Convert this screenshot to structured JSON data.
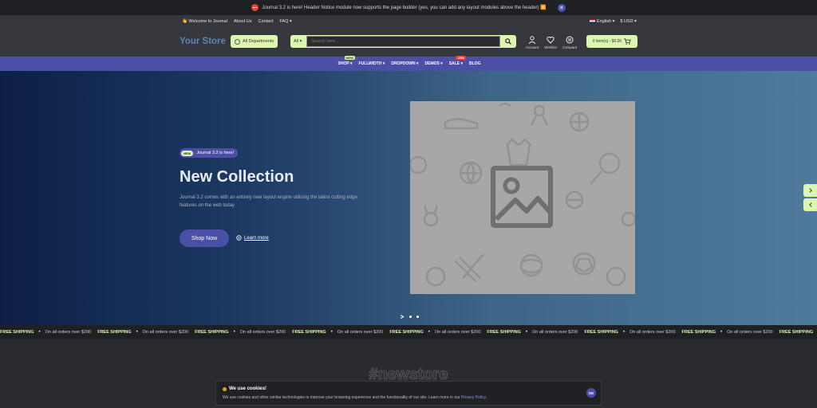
{
  "notice": {
    "text": "Journal 3.2 is here! Header Notice module now supports the page builder (yes, you can add any layout modules above the header) ⏸️"
  },
  "top_links": {
    "welcome": "👋 Welcome to Journal",
    "about": "About Us",
    "contact": "Contact",
    "faq": "FAQ",
    "language": "English",
    "currency": "$ USD"
  },
  "header": {
    "logo": "Your Store",
    "departments": "All Departments",
    "search_category": "All",
    "search_placeholder": "Search here...",
    "account": "Account",
    "wishlist": "Wishlist",
    "compare": "Compare",
    "cart": "0 item(s) - $0.00"
  },
  "nav": {
    "items": [
      {
        "label": "SHOP",
        "tag": "NEW"
      },
      {
        "label": "FULLWIDTH",
        "tag": ""
      },
      {
        "label": "DROPDOWN",
        "tag": ""
      },
      {
        "label": "DEMOS",
        "tag": ""
      },
      {
        "label": "SALE",
        "tag": "-15%"
      },
      {
        "label": "BLOG",
        "tag": ""
      }
    ]
  },
  "hero": {
    "badge_new": "NEW",
    "badge_text": "Journal 3.2 is here!",
    "title": "New Collection",
    "description": "Journal 3.2 comes with an entirely new layout engine utilising the latest cutting edge features on the web today",
    "shop_button": "Shop Now",
    "learn_more": "Learn more"
  },
  "ticker": {
    "bold": "FREE SHIPPING",
    "text": "On all orders over $200"
  },
  "section_heading": "#newstore",
  "cookie": {
    "title": "We use cookies!",
    "message": "We use cookies and other similar technologies to improve your browsing experience and the functionality of our site. Learn more in our",
    "link": "Privacy Policy.",
    "ok": "OK"
  },
  "colors": {
    "accent_green": "#dcf5b0",
    "accent_purple": "#4b4fa6",
    "background": "#2b2c30"
  }
}
